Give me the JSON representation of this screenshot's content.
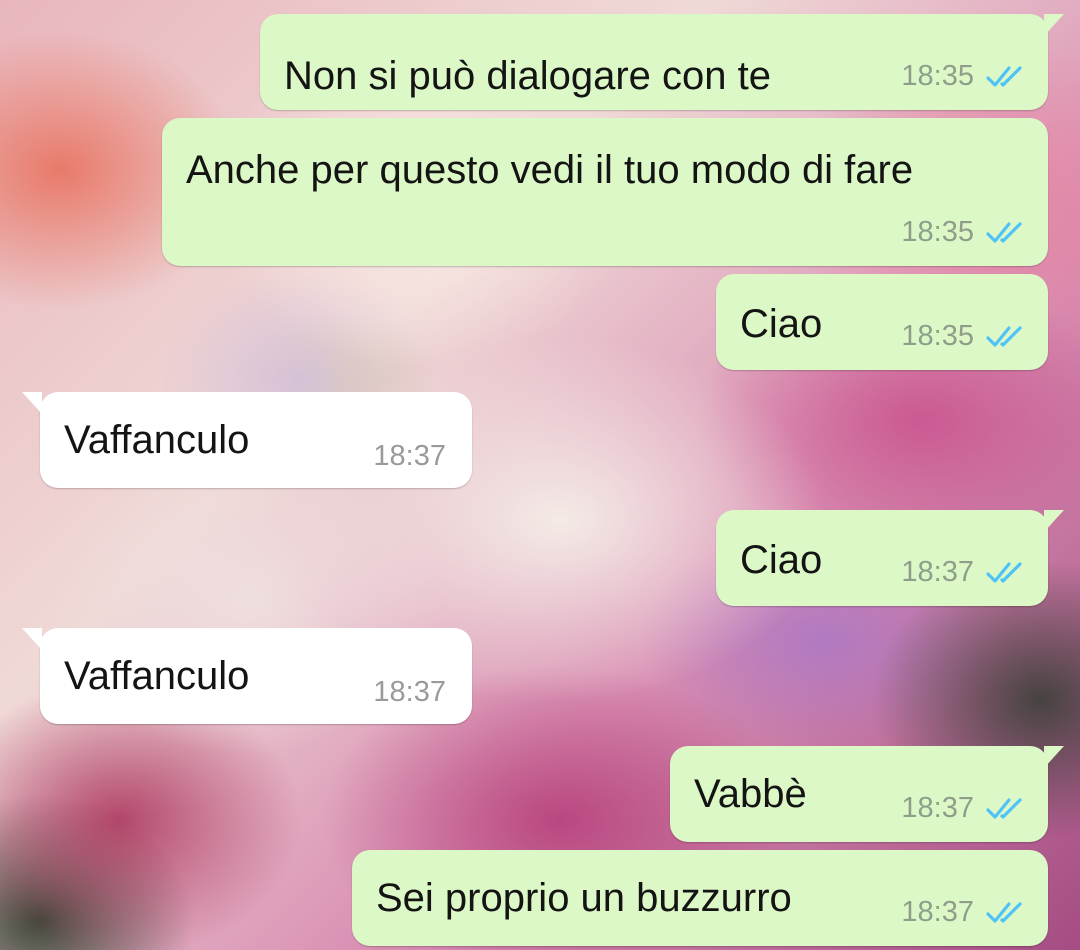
{
  "conversation": {
    "messages": [
      {
        "direction": "outgoing",
        "text": "Non si può dialogare con te",
        "time": "18:35",
        "status": "read-double-check-icon"
      },
      {
        "direction": "outgoing",
        "text": "Anche per questo vedi il tuo modo di fare",
        "time": "18:35",
        "status": "read-double-check-icon"
      },
      {
        "direction": "outgoing",
        "text": "Ciao",
        "time": "18:35",
        "status": "read-double-check-icon"
      },
      {
        "direction": "incoming",
        "text": "Vaffanculo",
        "time": "18:37"
      },
      {
        "direction": "outgoing",
        "text": "Ciao",
        "time": "18:37",
        "status": "read-double-check-icon"
      },
      {
        "direction": "incoming",
        "text": "Vaffanculo",
        "time": "18:37"
      },
      {
        "direction": "outgoing",
        "text": "Vabbè",
        "time": "18:37",
        "status": "read-double-check-icon"
      },
      {
        "direction": "outgoing",
        "text": "Sei proprio un buzzurro",
        "time": "18:37",
        "status": "read-double-check-icon"
      }
    ]
  },
  "colors": {
    "outgoing_bubble": "#dcf8c6",
    "incoming_bubble": "#ffffff",
    "read_tick": "#4fc3f7",
    "timestamp": "#8f9e8a"
  }
}
